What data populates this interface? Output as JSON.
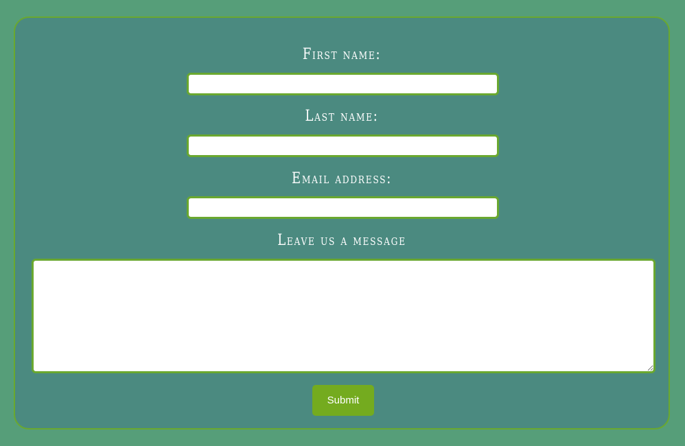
{
  "form": {
    "first_name": {
      "label": "First name:",
      "value": ""
    },
    "last_name": {
      "label": "Last name:",
      "value": ""
    },
    "email": {
      "label": "Email address:",
      "value": ""
    },
    "message": {
      "label": "Leave us a message",
      "value": ""
    },
    "submit_label": "Submit"
  },
  "colors": {
    "page_background": "#569e79",
    "card_background": "#4b8a80",
    "accent_green": "#6aa82f",
    "submit_background": "#74ab1f",
    "label_text": "#ffffff"
  }
}
